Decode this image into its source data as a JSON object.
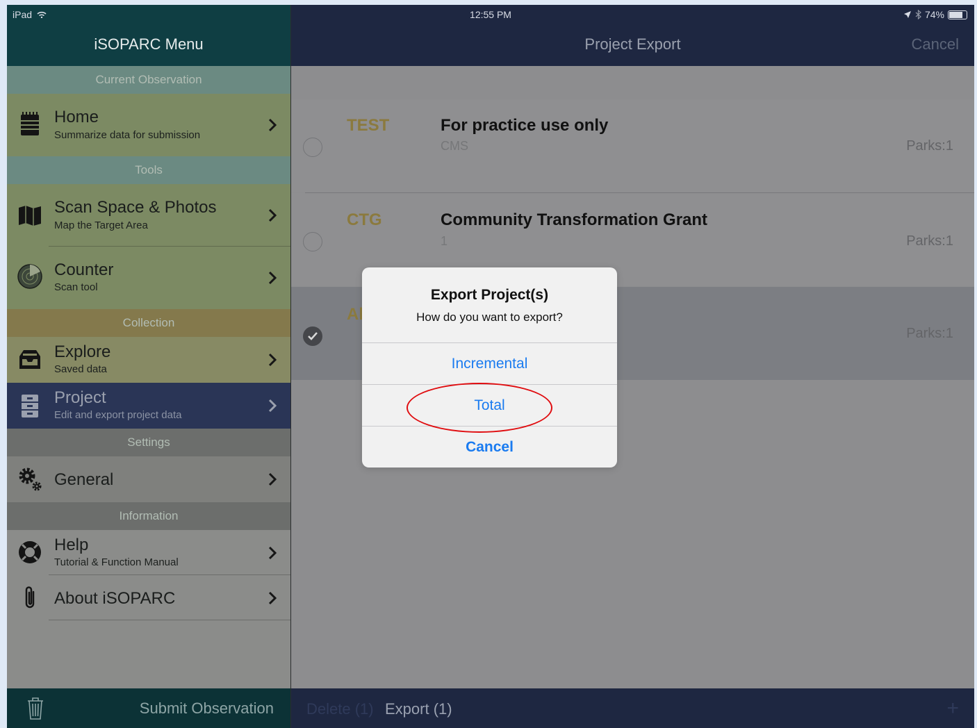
{
  "status_bar": {
    "device": "iPad",
    "time": "12:55 PM",
    "battery": "74%"
  },
  "sidebar": {
    "title": "iSOPARC Menu",
    "sections": {
      "current_observation": "Current Observation",
      "tools": "Tools",
      "collection": "Collection",
      "settings": "Settings",
      "information": "Information"
    },
    "items": {
      "home": {
        "label": "Home",
        "sub": "Summarize data for submission",
        "icon": "notepad-icon"
      },
      "scan_space": {
        "label": "Scan Space & Photos",
        "sub": "Map the Target Area",
        "icon": "map-icon"
      },
      "counter": {
        "label": "Counter",
        "sub": "Scan tool",
        "icon": "radar-icon"
      },
      "explore": {
        "label": "Explore",
        "sub": "Saved data",
        "icon": "inbox-icon"
      },
      "project": {
        "label": "Project",
        "sub": "Edit and export project data",
        "icon": "cabinet-icon"
      },
      "general": {
        "label": "General",
        "icon": "gears-icon"
      },
      "help": {
        "label": "Help",
        "sub": "Tutorial & Function Manual",
        "icon": "lifebuoy-icon"
      },
      "about": {
        "label": "About iSOPARC",
        "icon": "paperclip-icon"
      }
    },
    "footer": {
      "label": "Submit Observation",
      "icon": "trash-icon"
    }
  },
  "nav": {
    "title": "Project Export",
    "cancel": "Cancel"
  },
  "projects": [
    {
      "code": "TEST",
      "name": "For practice use only",
      "sub": "CMS",
      "parks": "Parks:1",
      "selected": false
    },
    {
      "code": "CTG",
      "name": "Community Transformation Grant",
      "sub": "1",
      "parks": "Parks:1",
      "selected": false
    },
    {
      "code": "Al",
      "name": "",
      "sub": "",
      "parks": "Parks:1",
      "selected": true
    }
  ],
  "bottom_bar": {
    "delete": "Delete (1)",
    "export": "Export (1)",
    "add": "+"
  },
  "alert": {
    "title": "Export Project(s)",
    "message": "How do you want to export?",
    "buttons": {
      "incremental": "Incremental",
      "total": "Total",
      "cancel": "Cancel"
    }
  },
  "colors": {
    "accent": "#1a7bf0",
    "highlight": "#e00d10",
    "code": "#8b7a3e",
    "selected_menu": "#2a3556"
  }
}
